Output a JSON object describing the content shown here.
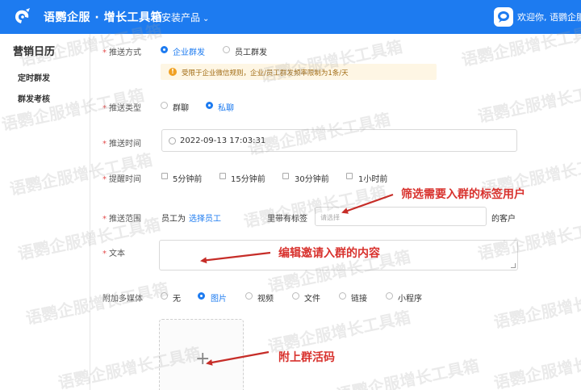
{
  "header": {
    "title": "语鹦企服 · 增长工具箱",
    "product_dropdown": "已安装产品",
    "welcome": "欢迎你, 语鹦企服小"
  },
  "sidebar": {
    "title": "营销日历",
    "items": [
      "定时群发",
      "群发考核"
    ]
  },
  "form": {
    "push_method": {
      "label": "推送方式",
      "options": [
        "企业群发",
        "员工群发"
      ],
      "selected": "企业群发"
    },
    "notice": "受限于企业微信规则，企业/员工群发频率限制为1条/天",
    "push_type": {
      "label": "推送类型",
      "options": [
        "群聊",
        "私聊"
      ],
      "selected": "私聊"
    },
    "push_time": {
      "label": "推送时间",
      "value": "2022-09-13 17:03:31"
    },
    "reminder": {
      "label": "提醒时间",
      "options": [
        "5分钟前",
        "15分钟前",
        "30分钟前",
        "1小时前"
      ]
    },
    "scope": {
      "label": "推送范围",
      "staff_prefix": "员工为",
      "staff_link": "选择员工",
      "tag_prefix": "里带有标签",
      "tag_placeholder": "请选择",
      "suffix": "的客户"
    },
    "text": {
      "label": "文本"
    },
    "media": {
      "label": "附加多媒体",
      "options": [
        "无",
        "图片",
        "视频",
        "文件",
        "链接",
        "小程序"
      ],
      "selected": "图片"
    }
  },
  "annotations": {
    "filter_tags": "筛选需要入群的标签用户",
    "edit_text": "编辑邀请入群的内容",
    "attach_qr": "附上群活码"
  },
  "watermark": "语鹦企服增长工具箱",
  "colors": {
    "primary": "#1d7bf0",
    "annotation": "#d8322e",
    "required": "#e34d4d"
  }
}
